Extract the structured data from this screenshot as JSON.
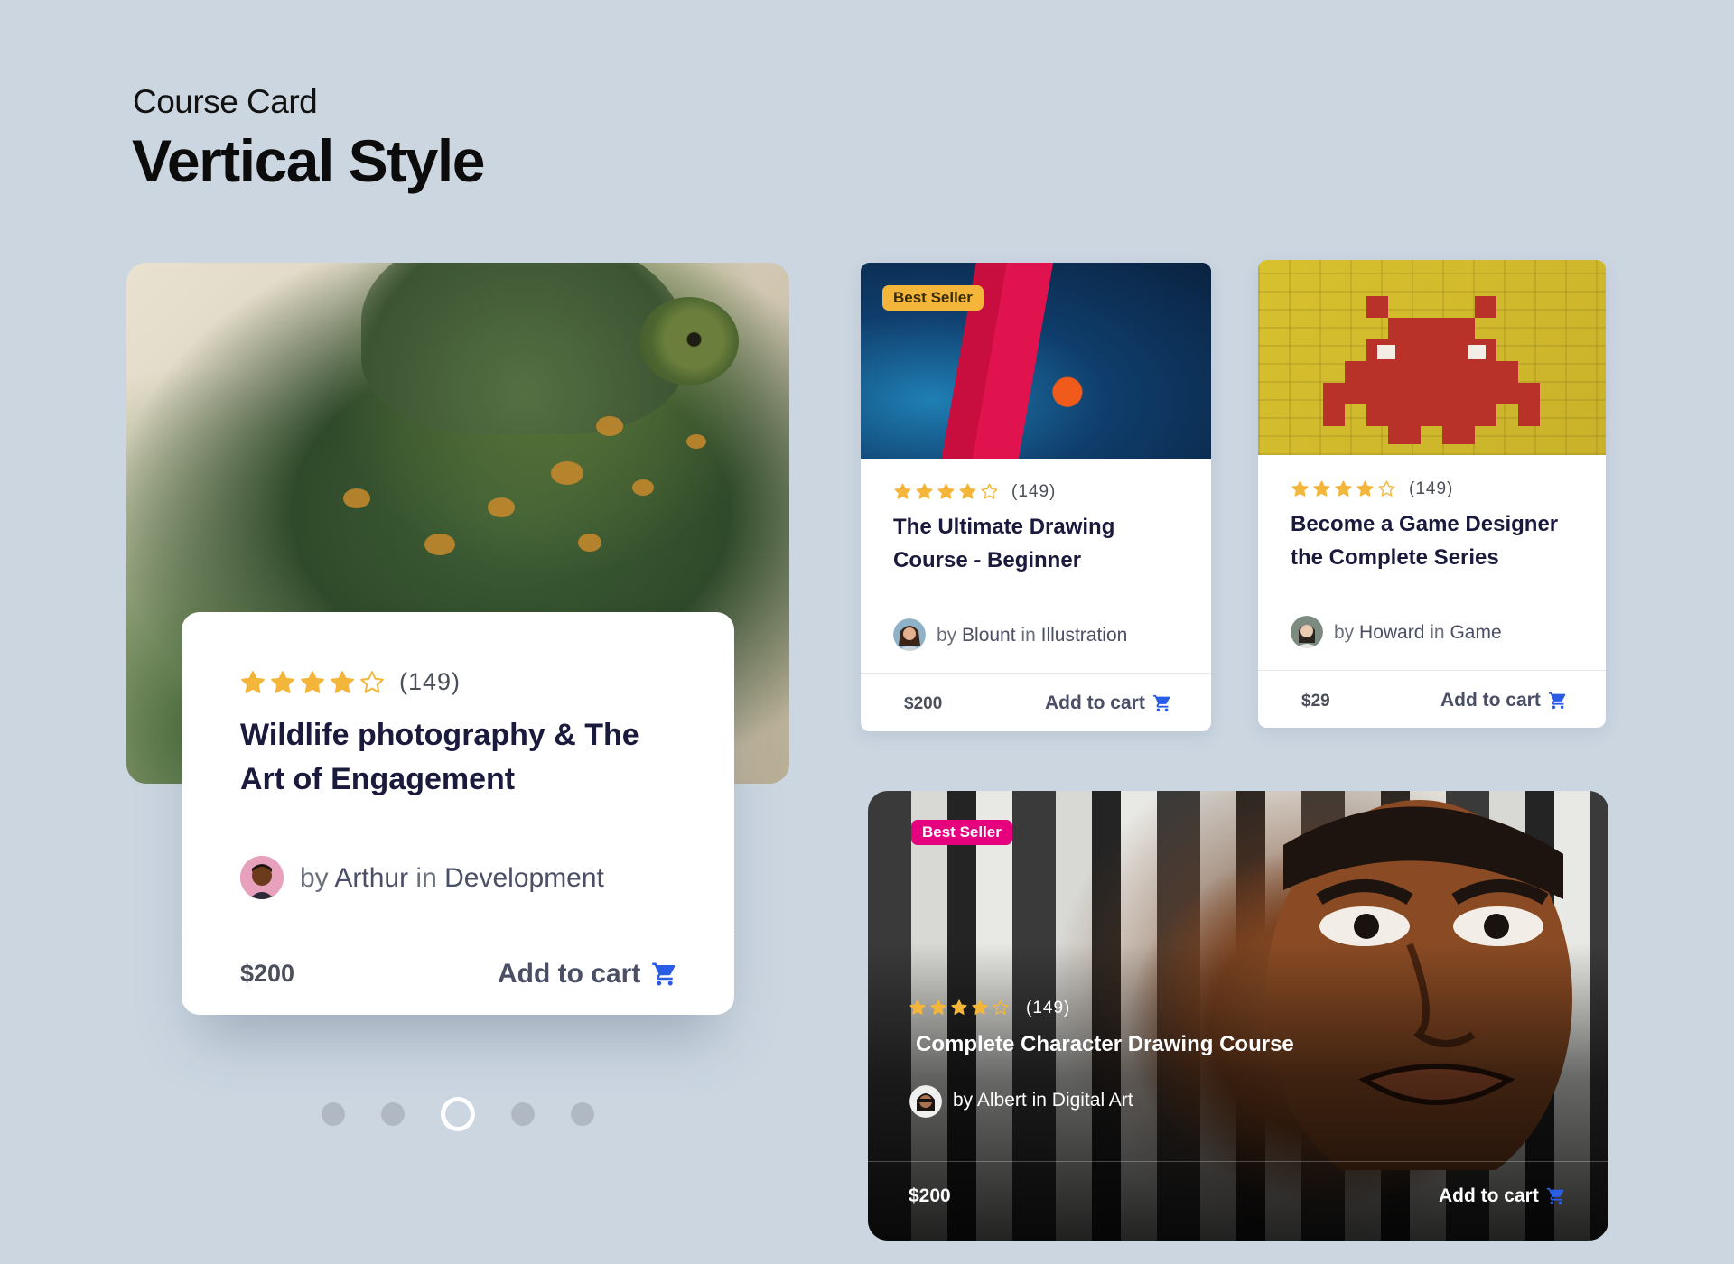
{
  "header": {
    "eyebrow": "Course Card",
    "title": "Vertical Style"
  },
  "colors": {
    "background": "#CBD6E1",
    "star": "#F3B63B",
    "cart_icon": "#2B5CE6",
    "badge_yellow": "#F3B63B",
    "badge_pink": "#E6007E"
  },
  "featured": {
    "rating": 4,
    "rating_max": 5,
    "count": "(149)",
    "title": "Wildlife photography & The Art of Engagement",
    "by": "by",
    "author": "Arthur",
    "in": "in",
    "category": "Development",
    "price": "$200",
    "cart_label": "Add to cart"
  },
  "pagination": {
    "total": 5,
    "active_index": 2
  },
  "cards": [
    {
      "badge": "Best Seller",
      "rating": 4,
      "count": "(149)",
      "title": "The Ultimate Drawing Course - Beginner",
      "by": "by",
      "author": "Blount",
      "in": "in",
      "category": "Illustration",
      "price": "$200",
      "cart_label": "Add to cart"
    },
    {
      "rating": 4,
      "count": "(149)",
      "title": "Become a Game Designer the Complete Series",
      "by": "by",
      "author": "Howard",
      "in": "in",
      "category": "Game",
      "price": "$29",
      "cart_label": "Add to cart"
    },
    {
      "badge": "Best Seller",
      "rating": 4,
      "count": "(149)",
      "title": "Complete Character Drawing Course",
      "by": "by",
      "author": "Albert",
      "in": "in",
      "category": "Digital Art",
      "price": "$200",
      "cart_label": "Add to cart"
    }
  ]
}
